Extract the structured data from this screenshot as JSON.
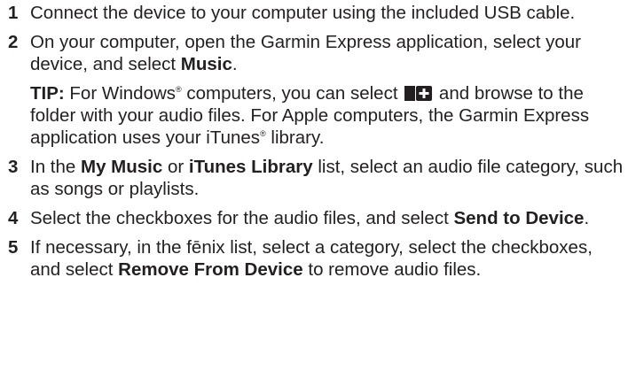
{
  "steps": [
    {
      "number": "1",
      "text": "Connect the device to your computer using the included USB cable."
    },
    {
      "number": "2",
      "text_before": "On your computer, open the Garmin Express application, select your device, and select ",
      "bold": "Music",
      "text_after": "."
    },
    {
      "number": "3",
      "text_1": "In the ",
      "bold_1": "My Music",
      "text_2": " or ",
      "bold_2": "iTunes Library",
      "text_3": " list, select an audio file category, such as songs or playlists."
    },
    {
      "number": "4",
      "text_before": "Select the checkboxes for the audio files, and select ",
      "bold": "Send to Device",
      "text_after": "."
    },
    {
      "number": "5",
      "text_before": "If necessary, in the fēnix list, select a category, select the checkboxes, and select ",
      "bold": "Remove From Device",
      "text_after": " to remove audio files."
    }
  ],
  "tip": {
    "label": "TIP:",
    "text_1": " For Windows",
    "reg_1": "®",
    "text_2": " computers, you can select ",
    "icon": "add-folder-icon",
    "text_3": " and browse to the folder with your audio files. For Apple computers, the Garmin Express application uses your iTunes",
    "reg_2": "®",
    "text_4": " library."
  }
}
